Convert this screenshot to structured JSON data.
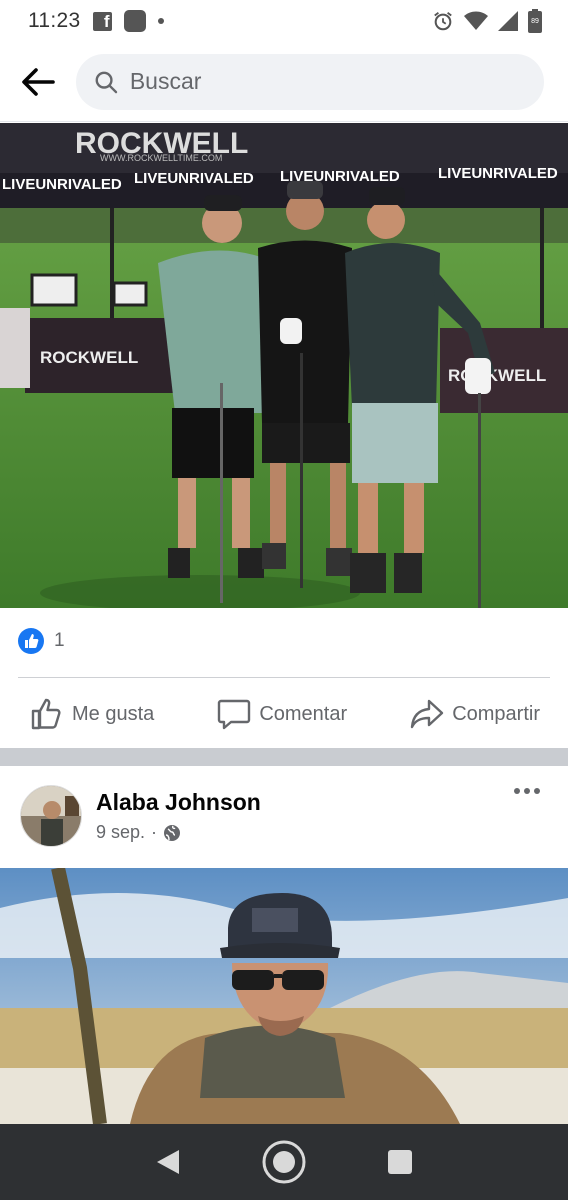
{
  "status_bar": {
    "time": "11:23",
    "icons": [
      "facebook-icon",
      "app-icon",
      "alarm-icon",
      "wifi-icon",
      "signal-icon",
      "battery-icon"
    ]
  },
  "search": {
    "placeholder": "Buscar"
  },
  "post1": {
    "photo": {
      "banner_brand": "ROCKWELL",
      "banner_url": "WWW.ROCKWELLTIME.COM",
      "banner_slogans": [
        "LIVEUNRIVALED",
        "LIVEUNRIVALED",
        "LIVEUNRIVALED",
        "LIVEUNRIVALED"
      ],
      "table_brand_left": "ROCKWELL",
      "table_brand_right": "ROCKWELL"
    },
    "reaction_count": "1",
    "actions": {
      "like": "Me gusta",
      "comment": "Comentar",
      "share": "Compartir"
    }
  },
  "post2": {
    "author": "Alaba Johnson",
    "date": "9 sep.",
    "separator": "·",
    "privacy_icon": "globe-icon"
  },
  "colors": {
    "brand_blue": "#1877f2",
    "secondary_text": "#65676b",
    "nav_bg": "#2e3033"
  }
}
